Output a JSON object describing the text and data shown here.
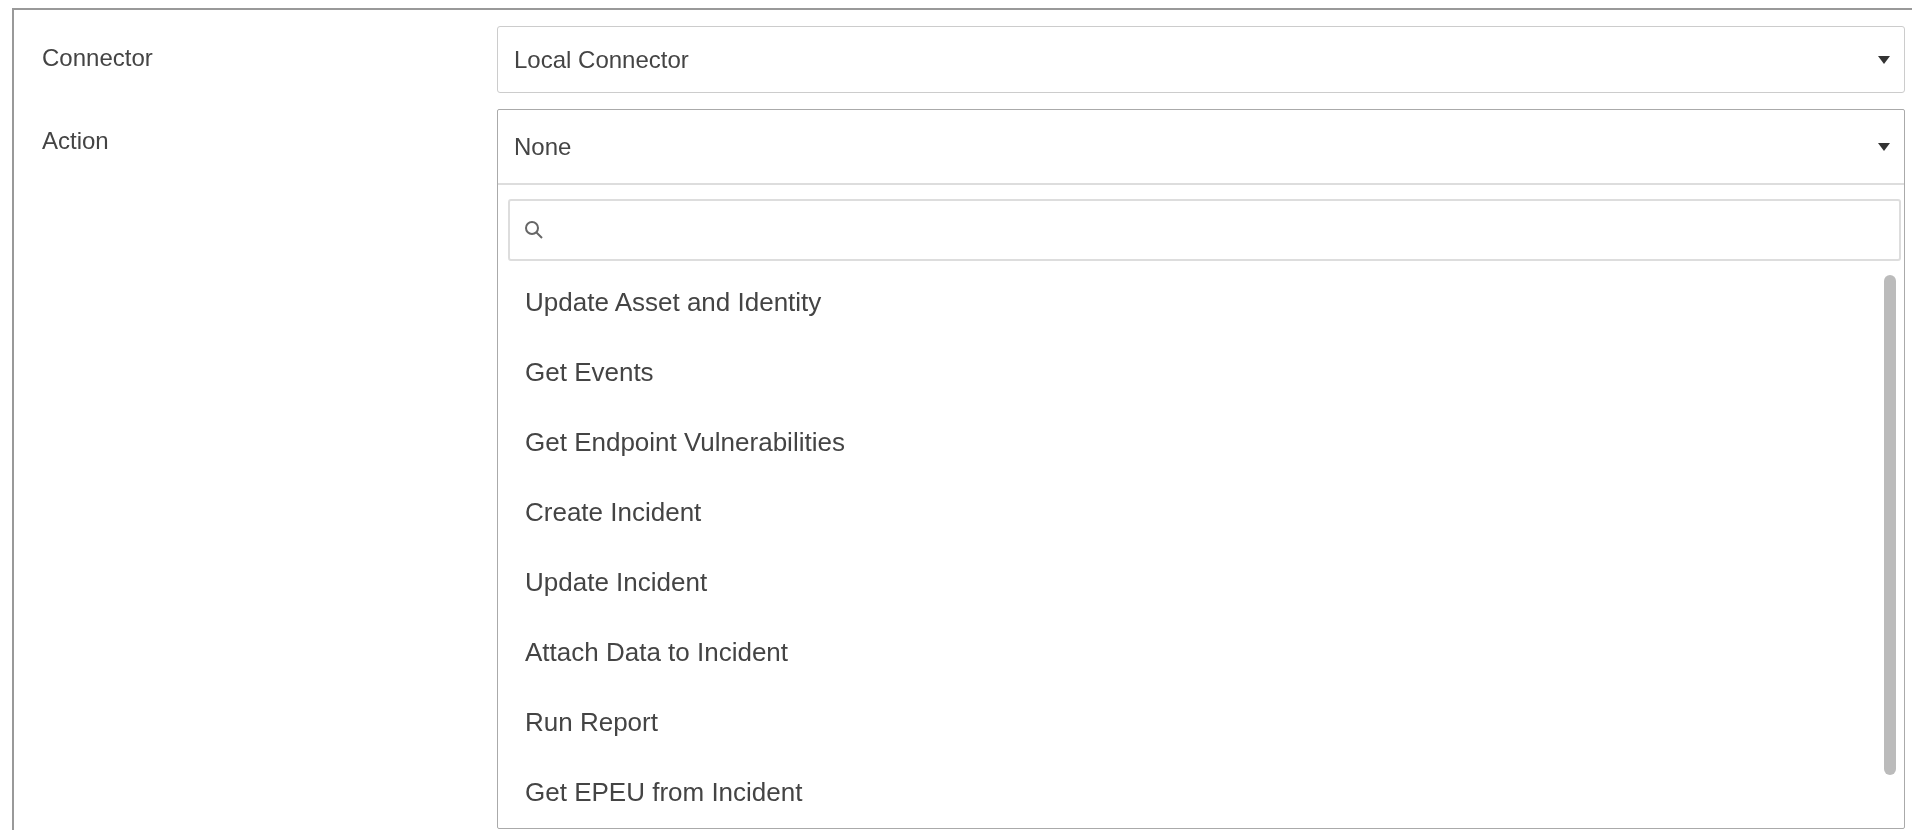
{
  "fields": [
    {
      "label": "Connector",
      "value": "Local Connector",
      "expanded": false
    },
    {
      "label": "Action",
      "value": "None",
      "expanded": true,
      "searchable": true,
      "options": [
        {
          "label": "Update Asset and Identity",
          "selected": false
        },
        {
          "label": "Get Events",
          "selected": false
        },
        {
          "label": "Get Endpoint Vulnerabilities",
          "selected": false
        },
        {
          "label": "Create Incident",
          "selected": false
        },
        {
          "label": "Update Incident",
          "selected": false
        },
        {
          "label": "Attach Data to Incident",
          "selected": false
        },
        {
          "label": "Run Report",
          "selected": false
        },
        {
          "label": "Get EPEU from Incident",
          "selected": false
        }
      ]
    }
  ]
}
